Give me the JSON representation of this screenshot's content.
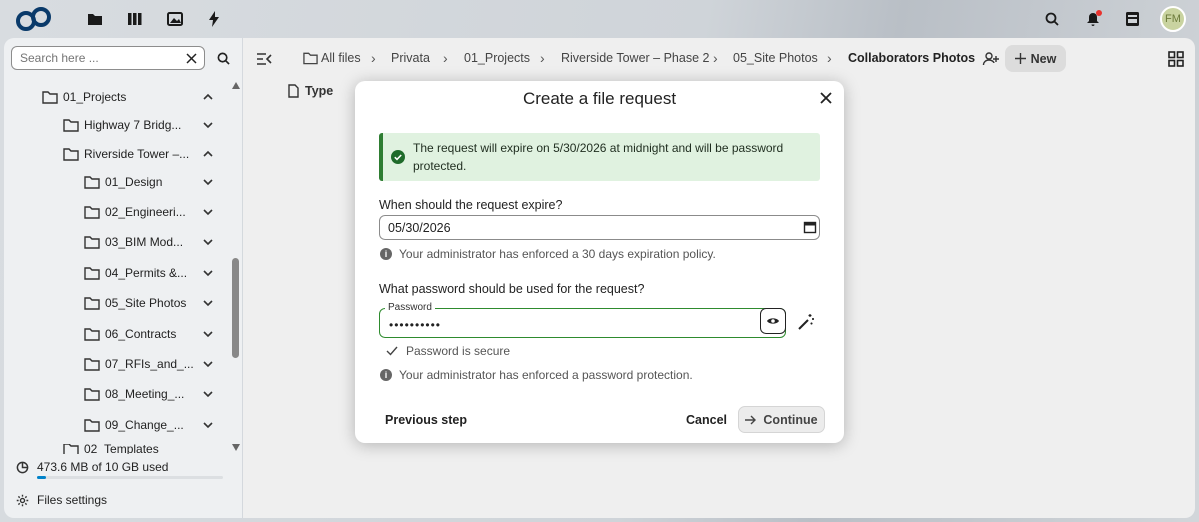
{
  "topbar": {
    "apps": [
      "files-icon",
      "deck-icon",
      "photos-icon",
      "activity-icon"
    ],
    "avatar_initials": "FM"
  },
  "sidebar": {
    "search": {
      "placeholder": "Search here ..."
    },
    "tree": [
      {
        "label": "01_Projects",
        "expanded": true
      },
      {
        "label": "Highway 7 Bridg...",
        "expanded": false
      },
      {
        "label": "Riverside Tower –...",
        "expanded": true
      },
      {
        "label": "01_Design",
        "expanded": false
      },
      {
        "label": "02_Engineeri...",
        "expanded": false
      },
      {
        "label": "03_BIM Mod...",
        "expanded": false
      },
      {
        "label": "04_Permits &...",
        "expanded": false
      },
      {
        "label": "05_Site Photos",
        "expanded": false
      },
      {
        "label": "06_Contracts",
        "expanded": false
      },
      {
        "label": "07_RFIs_and_...",
        "expanded": false
      },
      {
        "label": "08_Meeting_...",
        "expanded": false
      },
      {
        "label": "09_Change_...",
        "expanded": false
      },
      {
        "label": "02_Templates",
        "expanded": false
      }
    ],
    "quota_text": "473.6 MB of 10 GB used",
    "quota_percent": 4.6,
    "settings_label": "Files settings"
  },
  "breadcrumbs": [
    "All files",
    "Privata",
    "01_Projects",
    "Riverside Tower – Phase 2",
    "05_Site Photos",
    "Collaborators Photos"
  ],
  "toolbar": {
    "new_label": "New"
  },
  "list": {
    "type_header": "Type"
  },
  "dialog": {
    "title": "Create a file request",
    "notice": "The request will expire on 5/30/2026 at midnight and will be password protected.",
    "expire_label": "When should the request expire?",
    "expire_value": "05/30/2026",
    "expire_hint": "Your administrator has enforced a 30 days expiration policy.",
    "password_question": "What password should be used for the request?",
    "password_label": "Password",
    "password_value": "••••••••••",
    "password_secure": "Password is secure",
    "password_hint": "Your administrator has enforced a password protection.",
    "previous_label": "Previous step",
    "cancel_label": "Cancel",
    "continue_label": "Continue"
  },
  "colors": {
    "accent": "#0082c9",
    "success": "#2e7d32",
    "success_bg": "#e0f2e0"
  }
}
